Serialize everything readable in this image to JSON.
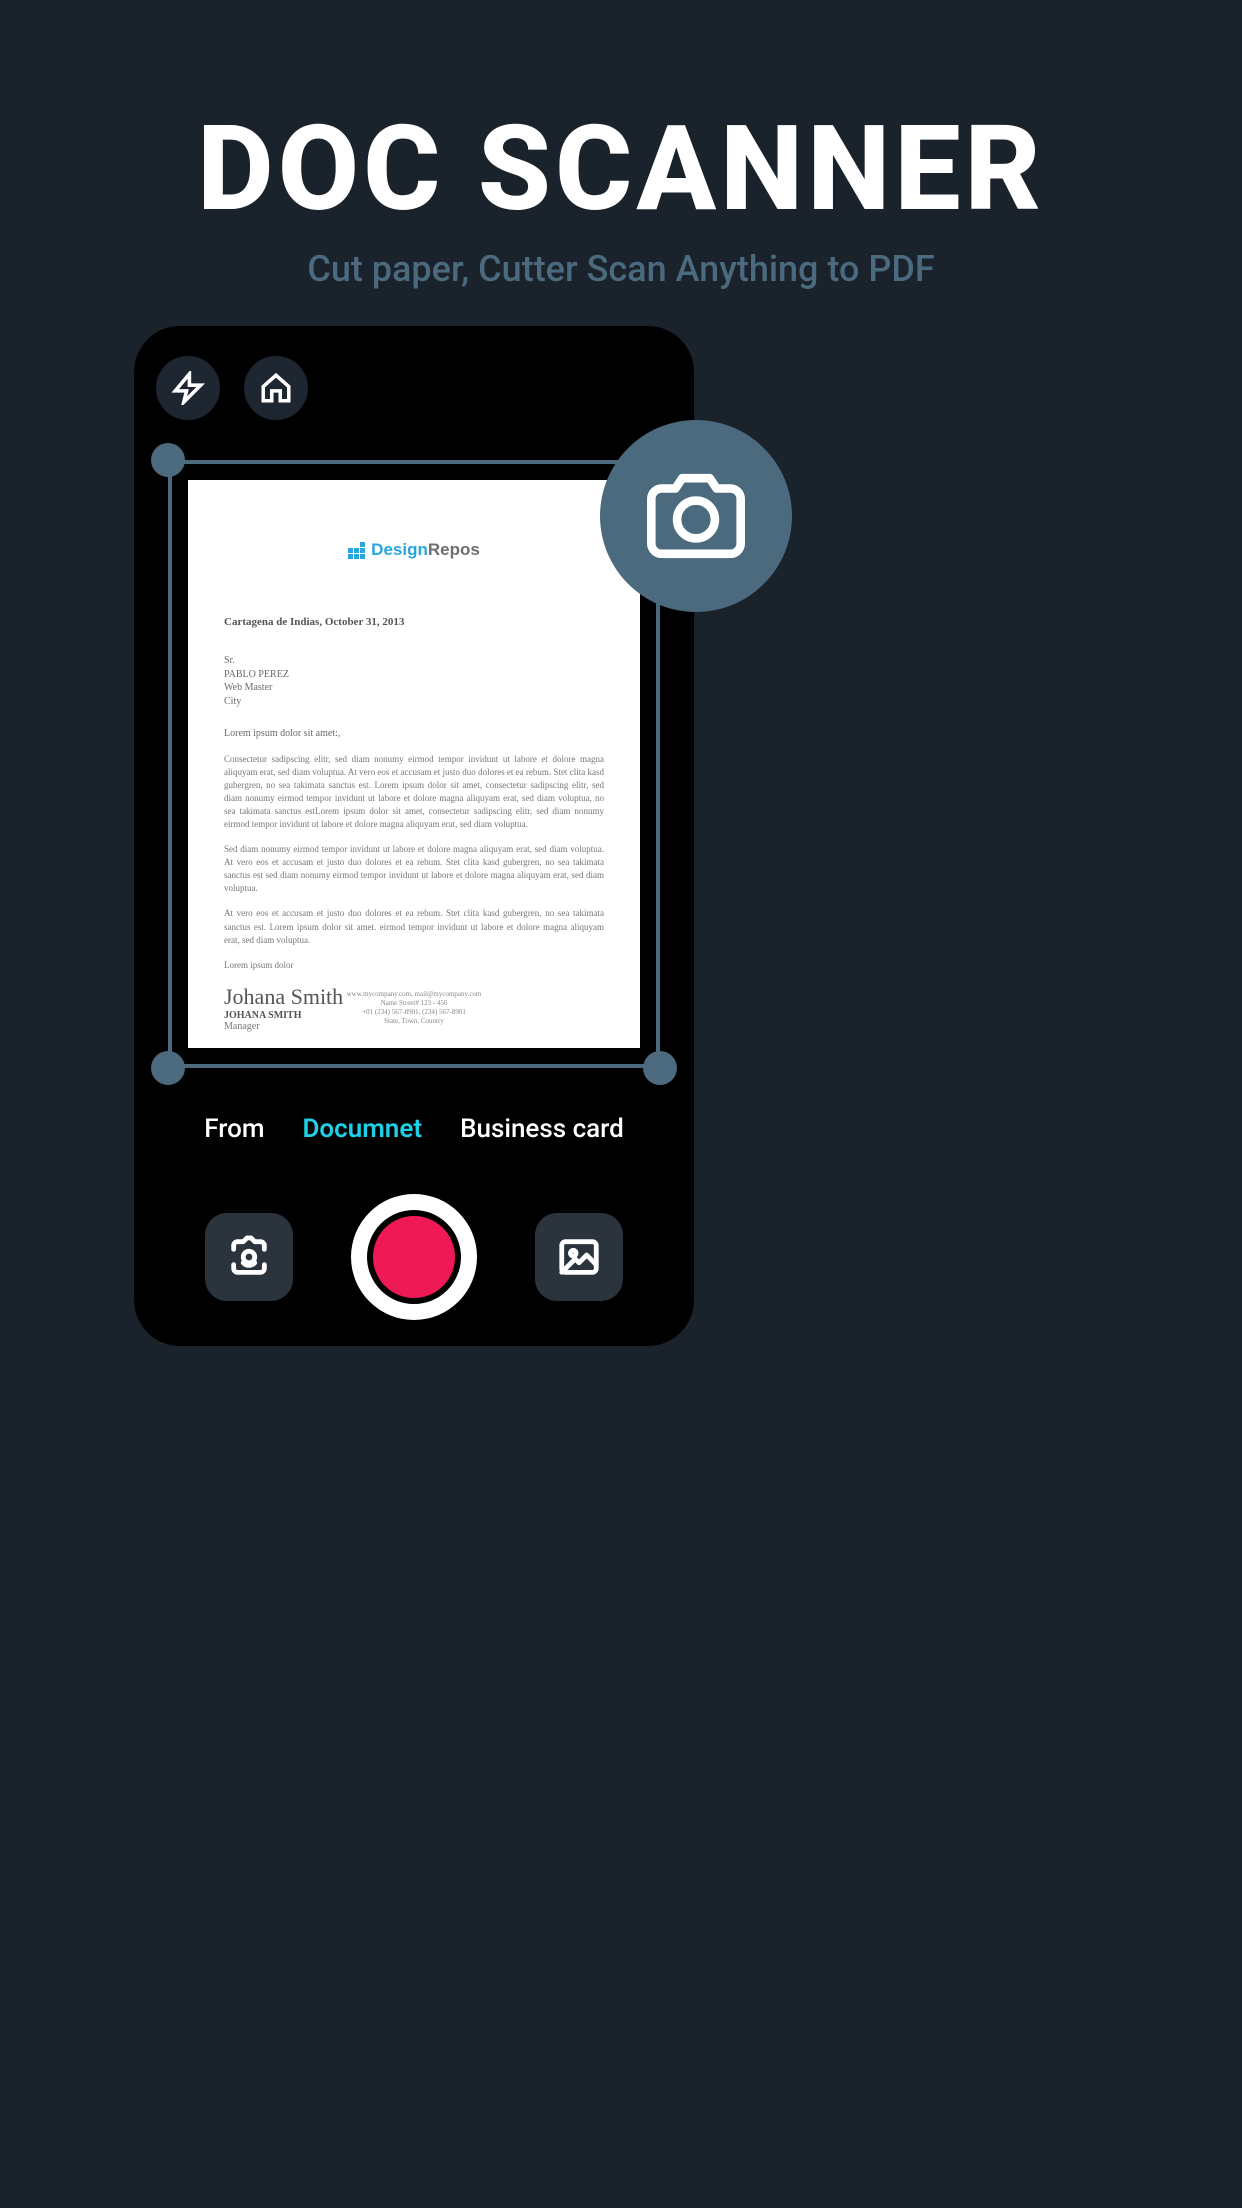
{
  "hero": {
    "title": "DOC SCANNER",
    "subtitle": "Cut paper, Cutter Scan Anything to PDF"
  },
  "modes": {
    "items": [
      "From",
      "Documnet",
      "Business card"
    ],
    "active_index": 1
  },
  "icons": {
    "flash": "flash-icon",
    "home": "home-icon",
    "switch_camera": "switch-camera-icon",
    "gallery": "gallery-icon",
    "camera_badge": "camera-icon"
  },
  "colors": {
    "background": "#1a222c",
    "accent_teal": "#1ed0e6",
    "handle": "#4b6a7e",
    "shutter": "#ef1955"
  },
  "document": {
    "logo_text_1": "Design",
    "logo_text_2": "Repos",
    "date_line": "Cartagena de Indias, October 31, 2013",
    "address": "Sr.\nPABLO PEREZ\nWeb Master\nCity",
    "lead": "Lorem ipsum dolor sit amet:,",
    "para1": "Consectetur sadipscing elitr, sed diam nonumy eirmod tempor invidunt ut labore et dolore magna aliquyam erat, sed diam voluptua. At vero eos et accusam et justo duo dolores et ea rebum. Stet clita kasd gubergren, no sea takimata sanctus est. Lorem ipsum dolor sit amet, consectetur sadipscing elitr, sed diam nonumy eirmod tempor invidunt ut labore et dolore magna aliquyam erat, sed diam voluptua, no sea takimata sanctus estLorem ipsum dolor sit amet, consectetur sadipscing elitr, sed diam nonumy eirmod tempor invidunt ut labore et dolore magna aliquyam erat, sed diam voluptua.",
    "para2": "Sed diam nonumy eirmod tempor invidunt ut labore et dolore magna aliquyam erat, sed diam voluptua. At vero eos et accusam et justo duo dolores et ea rebum. Stet clita kasd gubergren, no sea takimata sanctus est  sed diam nonumy eirmod tempor invidunt ut labore et dolore magna aliquyam erat, sed diam voluptua.",
    "para3": "At vero eos et accusam et justo duo dolores et ea rebum. Stet clita kasd gubergren, no sea takimata sanctus est. Lorem ipsum dolor sit amet.  eirmod tempor invidunt ut labore et dolore magna aliquyam erat, sed diam voluptua.",
    "closing": "Lorem ipsum dolor",
    "signature_script": "Johana Smith",
    "signer": "JOHANA SMITH",
    "signer_role": "Manager",
    "footer_line1": "www.mycompany.com, mail@mycompany.com",
    "footer_line2": "Name Street# 123 - 456",
    "footer_line3": "+01 (234) 567-8901, (234) 567-8901",
    "footer_line4": "State, Town, Country"
  }
}
